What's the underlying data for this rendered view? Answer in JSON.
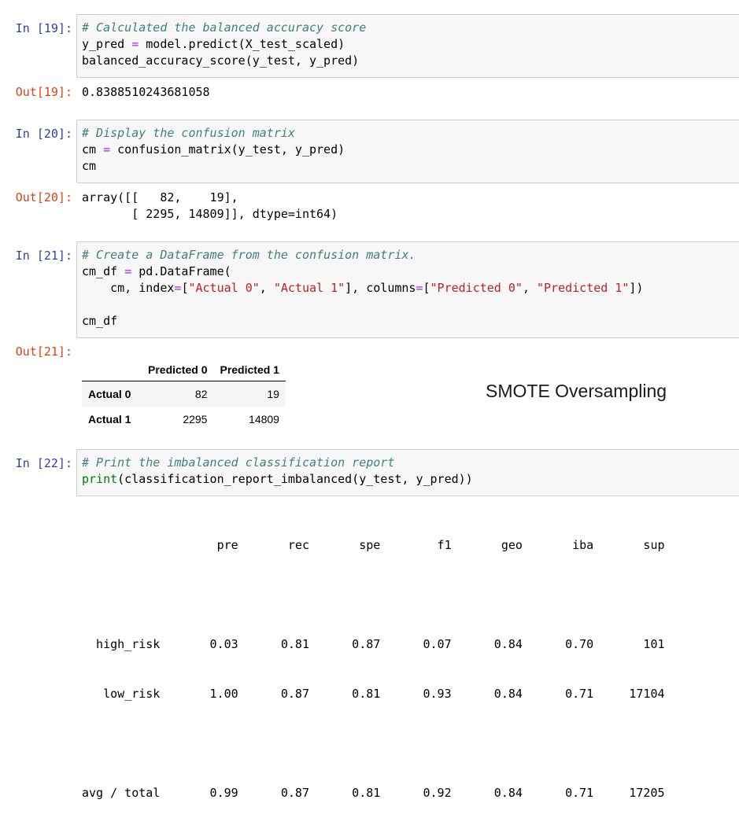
{
  "cells": [
    {
      "in_prompt": "In [19]:",
      "code": {
        "comment": "# Calculated the balanced accuracy score",
        "line2_a": "y_pred ",
        "line2_op": "=",
        "line2_b": " model.predict(X_test_scaled)",
        "line3": "balanced_accuracy_score(y_test, y_pred)"
      },
      "out_prompt": "Out[19]:",
      "output": "0.8388510243681058"
    },
    {
      "in_prompt": "In [20]:",
      "code": {
        "comment": "# Display the confusion matrix",
        "line2_a": "cm ",
        "line2_op": "=",
        "line2_b": " confusion_matrix(y_test, y_pred)",
        "line3": "cm"
      },
      "out_prompt": "Out[20]:",
      "output_line1": "array([[   82,    19],",
      "output_line2": "       [ 2295, 14809]], dtype=int64)"
    },
    {
      "in_prompt": "In [21]:",
      "code": {
        "comment": "# Create a DataFrame from the confusion matrix.",
        "line2_a": "cm_df ",
        "line2_op": "=",
        "line2_b": " pd.DataFrame(",
        "line3_a": "    cm, index",
        "line3_op1": "=",
        "line3_b": "[",
        "line3_s1": "\"Actual 0\"",
        "line3_c": ", ",
        "line3_s2": "\"Actual 1\"",
        "line3_d": "], columns",
        "line3_op2": "=",
        "line3_e": "[",
        "line3_s3": "\"Predicted 0\"",
        "line3_f": ", ",
        "line3_s4": "\"Predicted 1\"",
        "line3_g": "])",
        "line5": "cm_df"
      },
      "out_prompt": "Out[21]:",
      "dataframe": {
        "columns": [
          "Predicted 0",
          "Predicted 1"
        ],
        "rows": [
          {
            "index": "Actual 0",
            "values": [
              "82",
              "19"
            ]
          },
          {
            "index": "Actual 1",
            "values": [
              "2295",
              "14809"
            ]
          }
        ]
      },
      "annotation": "SMOTE Oversampling"
    },
    {
      "in_prompt": "In [22]:",
      "code": {
        "comment": "# Print the imbalanced classification report",
        "line2_fn": "print",
        "line2_rest": "(classification_report_imbalanced(y_test, y_pred))"
      },
      "report": {
        "header": "                   pre       rec       spe        f1       geo       iba       sup",
        "row1": "  high_risk       0.03      0.81      0.87      0.07      0.84      0.70       101",
        "row2": "   low_risk       1.00      0.87      0.81      0.93      0.84      0.71     17104",
        "total": "avg / total       0.99      0.87      0.81      0.92      0.84      0.71     17205"
      }
    }
  ]
}
